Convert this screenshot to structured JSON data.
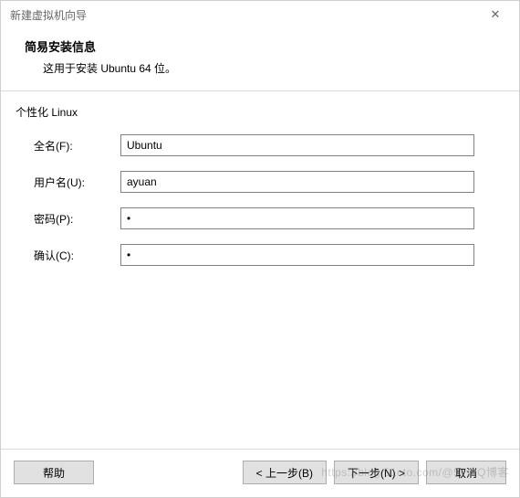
{
  "window": {
    "title": "新建虚拟机向导"
  },
  "header": {
    "title": "简易安装信息",
    "subtitle": "这用于安装 Ubuntu 64 位。"
  },
  "section": {
    "label": "个性化 Linux"
  },
  "form": {
    "fullname": {
      "label": "全名(F):",
      "value": "Ubuntu"
    },
    "username": {
      "label": "用户名(U):",
      "value": "ayuan"
    },
    "password": {
      "label": "密码(P):",
      "value": "•"
    },
    "confirm": {
      "label": "确认(C):",
      "value": "•"
    }
  },
  "footer": {
    "help": "帮助",
    "back": "< 上一步(B)",
    "next": "下一步(N) >",
    "cancel": "取消"
  },
  "watermark": "https://blog.51cto.com/@5Tb/Q博客"
}
